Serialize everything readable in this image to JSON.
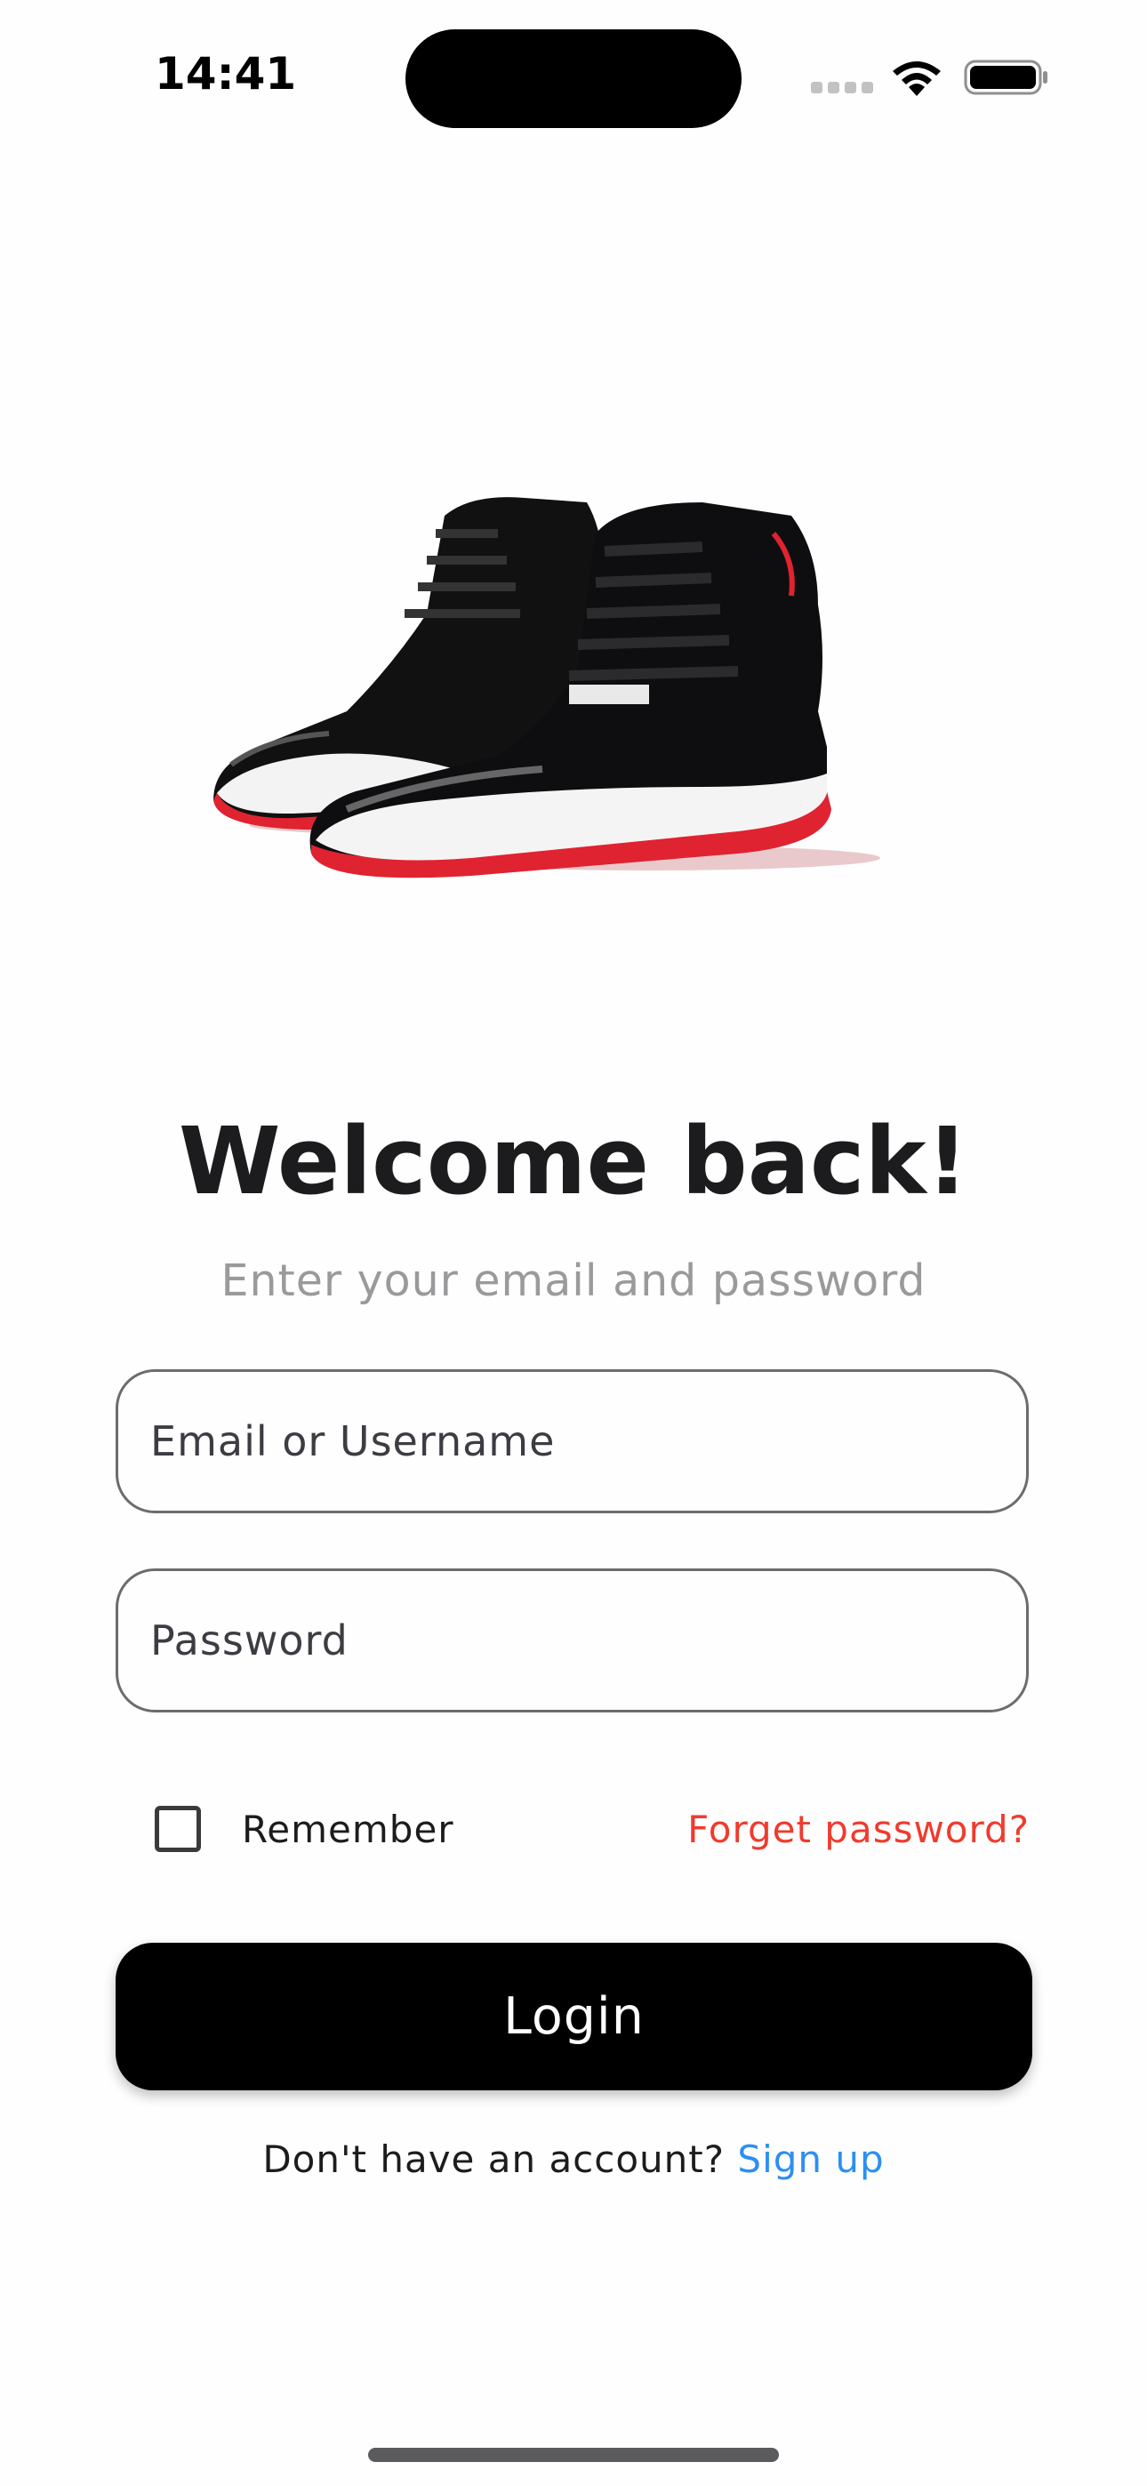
{
  "status_bar": {
    "time": "14:41",
    "signal_icon": "cellular-signal-icon",
    "wifi_icon": "wifi-icon",
    "battery_icon": "battery-icon"
  },
  "hero": {
    "image_icon": "sneaker-image",
    "colors": {
      "black": "#0d0d0f",
      "red": "#e02330",
      "white": "#f1f1f1"
    }
  },
  "login": {
    "title": "Welcome back!",
    "subtitle": "Enter your email and password",
    "email_placeholder": "Email or Username",
    "password_placeholder": "Password",
    "remember_label": "Remember",
    "remember_checked": false,
    "forgot_label": "Forget password?",
    "login_button_label": "Login",
    "signup_prompt": "Don't have an account?",
    "signup_link_label": "Sign up"
  },
  "colors": {
    "accent_blue": "#2c8ff2",
    "accent_red": "#ef3b2e",
    "primary": "#000000"
  }
}
